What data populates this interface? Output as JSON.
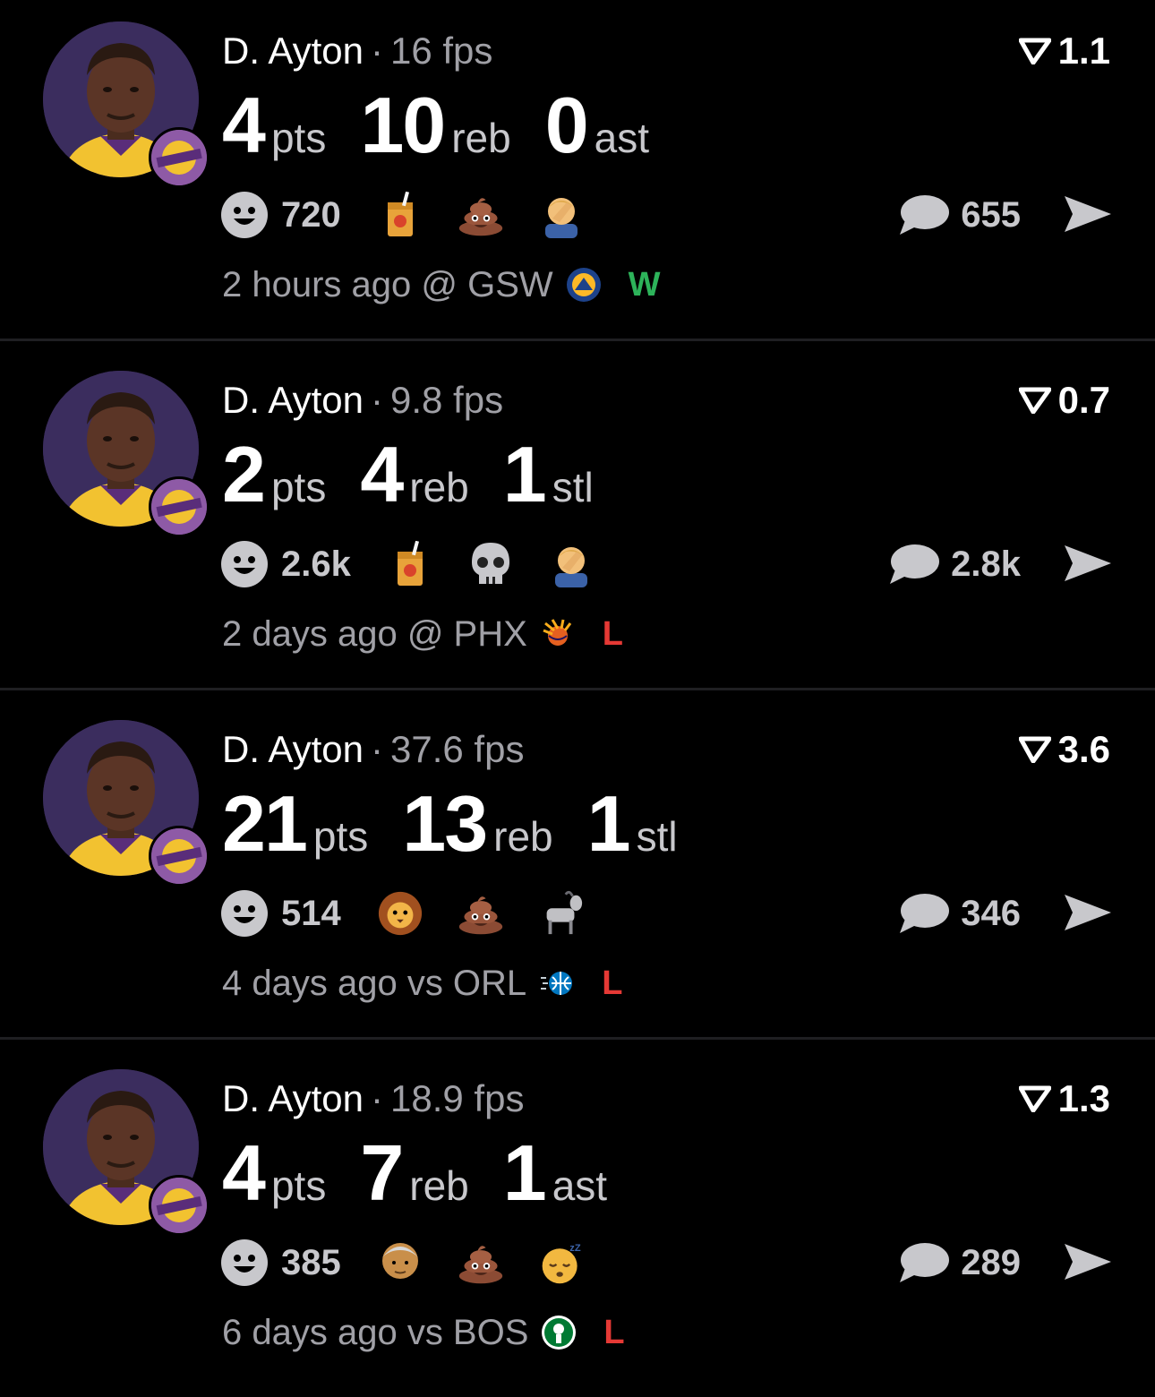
{
  "colors": {
    "background": "#000000",
    "muted": "#a0a0a6",
    "win": "#2db35a",
    "loss": "#e53935"
  },
  "cards": [
    {
      "player": "D. Ayton",
      "sep": "·",
      "fps": "16 fps",
      "rating": "1.1",
      "stats": [
        {
          "value": "4",
          "label": "pts"
        },
        {
          "value": "10",
          "label": "reb"
        },
        {
          "value": "0",
          "label": "ast"
        }
      ],
      "reaction_count": "720",
      "emojis": [
        "juice-box-icon",
        "poop-icon",
        "facepalm-icon"
      ],
      "comment_count": "655",
      "game": "2 hours ago @ GSW",
      "opponent_logo": "warriors-logo-icon",
      "result": "W"
    },
    {
      "player": "D. Ayton",
      "sep": "·",
      "fps": "9.8 fps",
      "rating": "0.7",
      "stats": [
        {
          "value": "2",
          "label": "pts"
        },
        {
          "value": "4",
          "label": "reb"
        },
        {
          "value": "1",
          "label": "stl"
        }
      ],
      "reaction_count": "2.6k",
      "emojis": [
        "juice-box-icon",
        "skull-icon",
        "facepalm-icon"
      ],
      "comment_count": "2.8k",
      "game": "2 days ago @ PHX",
      "opponent_logo": "suns-logo-icon",
      "result": "L"
    },
    {
      "player": "D. Ayton",
      "sep": "·",
      "fps": "37.6 fps",
      "rating": "3.6",
      "stats": [
        {
          "value": "21",
          "label": "pts"
        },
        {
          "value": "13",
          "label": "reb"
        },
        {
          "value": "1",
          "label": "stl"
        }
      ],
      "reaction_count": "514",
      "emojis": [
        "lion-icon",
        "poop-icon",
        "goat-icon"
      ],
      "comment_count": "346",
      "game": "4 days ago vs ORL",
      "opponent_logo": "magic-logo-icon",
      "result": "L"
    },
    {
      "player": "D. Ayton",
      "sep": "·",
      "fps": "18.9 fps",
      "rating": "1.3",
      "stats": [
        {
          "value": "4",
          "label": "pts"
        },
        {
          "value": "7",
          "label": "reb"
        },
        {
          "value": "1",
          "label": "ast"
        }
      ],
      "reaction_count": "385",
      "emojis": [
        "old-man-icon",
        "poop-icon",
        "sleeping-face-icon"
      ],
      "comment_count": "289",
      "game": "6 days ago vs BOS",
      "opponent_logo": "celtics-logo-icon",
      "result": "L"
    }
  ]
}
